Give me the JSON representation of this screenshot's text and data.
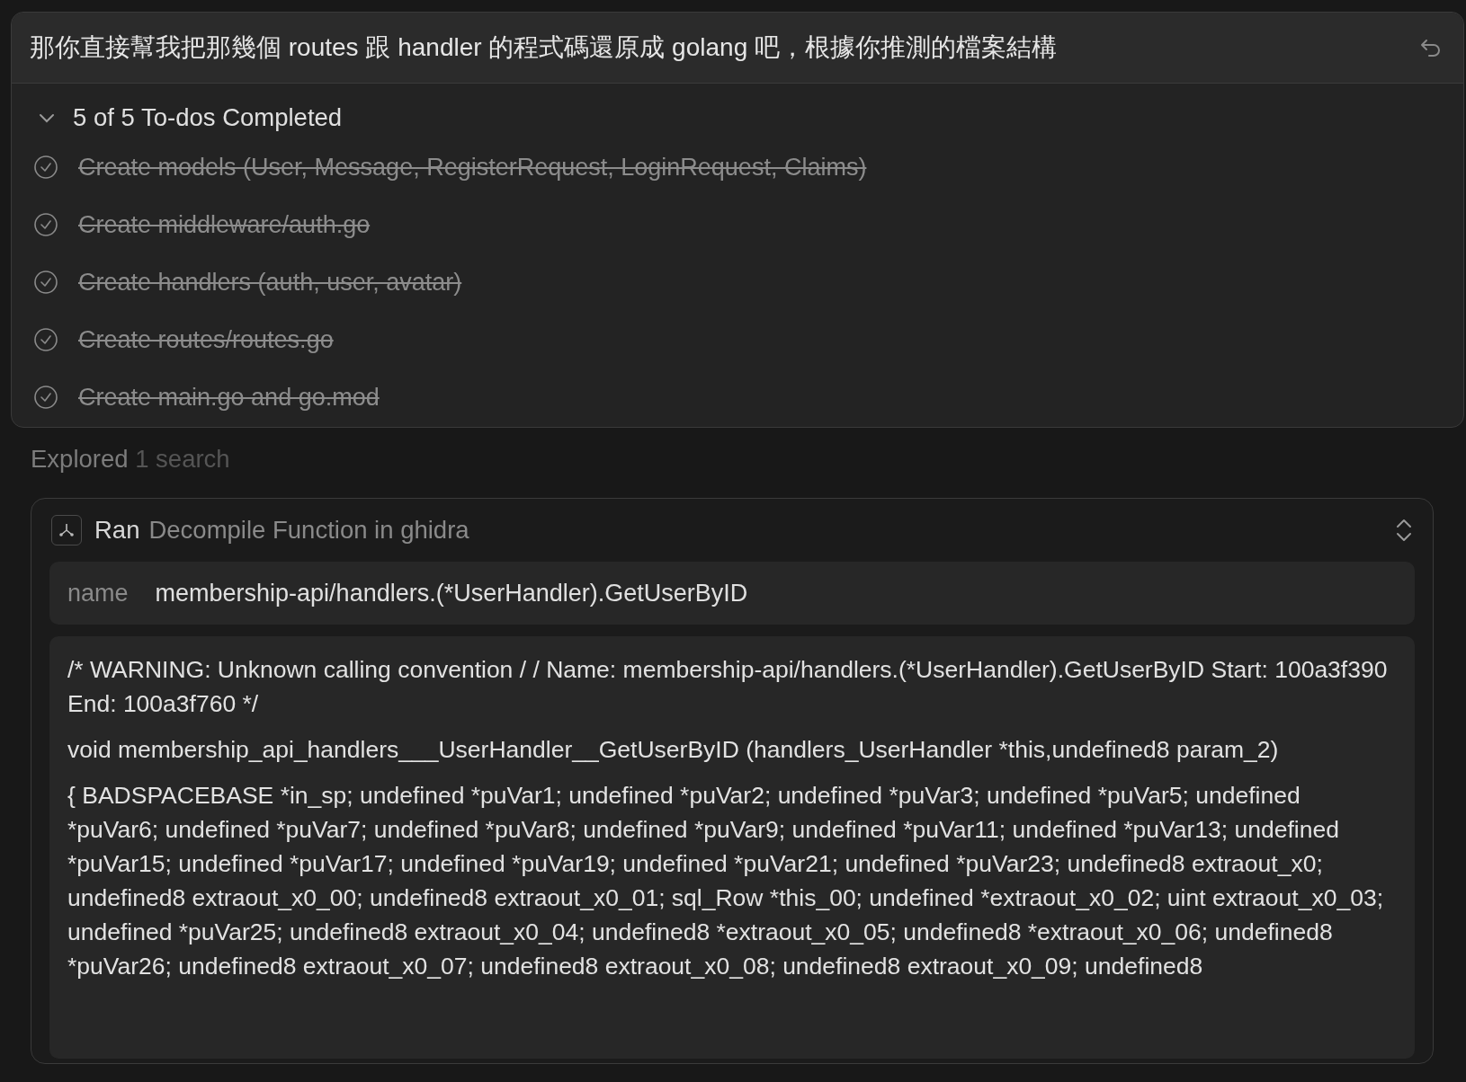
{
  "prompt": {
    "text": "那你直接幫我把那幾個 routes 跟 handler 的程式碼還原成 golang 吧，根據你推測的檔案結構"
  },
  "todos": {
    "summary": "5 of 5 To-dos Completed",
    "expanded": true,
    "items": [
      {
        "label": "Create models (User, Message, RegisterRequest, LoginRequest, Claims)",
        "completed": true
      },
      {
        "label": "Create middleware/auth.go",
        "completed": true
      },
      {
        "label": "Create handlers (auth, user, avatar)",
        "completed": true
      },
      {
        "label": "Create routes/routes.go",
        "completed": true
      },
      {
        "label": "Create main.go and go.mod",
        "completed": true
      }
    ]
  },
  "explored": {
    "label": "Explored",
    "detail": "1 search"
  },
  "tool_call": {
    "verb": "Ran",
    "title": "Decompile Function in ghidra",
    "param_name": "name",
    "param_value": "membership-api/handlers.(*UserHandler).GetUserByID",
    "output": [
      "/* WARNING: Unknown calling convention / / Name: membership-api/handlers.(*UserHandler).GetUserByID Start: 100a3f390 End: 100a3f760 */",
      "void membership_api_handlers___UserHandler__GetUserByID (handlers_UserHandler *this,undefined8 param_2)",
      "{ BADSPACEBASE *in_sp; undefined *puVar1; undefined *puVar2; undefined *puVar3; undefined *puVar5; undefined *puVar6; undefined *puVar7; undefined *puVar8; undefined *puVar9; undefined *puVar11; undefined *puVar13; undefined *puVar15; undefined *puVar17; undefined *puVar19; undefined *puVar21; undefined *puVar23; undefined8 extraout_x0; undefined8 extraout_x0_00; undefined8 extraout_x0_01; sql_Row *this_00; undefined *extraout_x0_02; uint extraout_x0_03; undefined *puVar25; undefined8 extraout_x0_04; undefined8 *extraout_x0_05; undefined8 *extraout_x0_06; undefined8 *puVar26; undefined8 extraout_x0_07; undefined8 extraout_x0_08; undefined8 extraout_x0_09; undefined8"
    ]
  }
}
